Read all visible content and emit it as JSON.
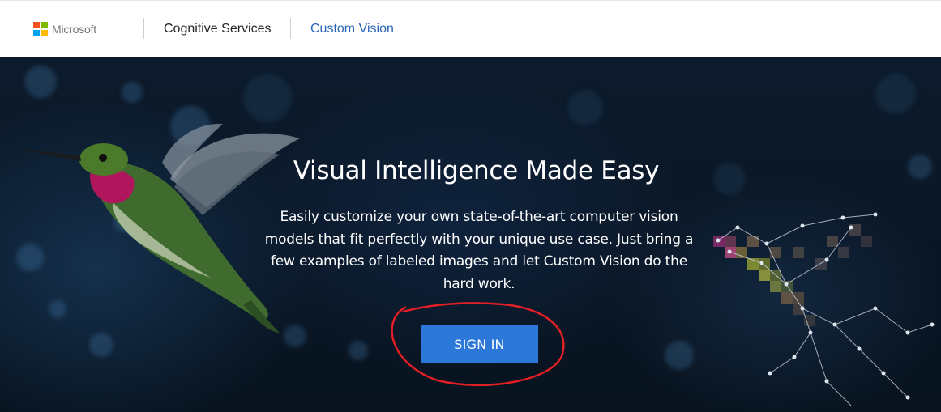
{
  "header": {
    "brand": "Microsoft",
    "nav": [
      {
        "label": "Cognitive Services"
      },
      {
        "label": "Custom Vision"
      }
    ]
  },
  "hero": {
    "title": "Visual Intelligence Made Easy",
    "description": "Easily customize your own state-of-the-art computer vision models that fit perfectly with your unique use case. Just bring a few examples of labeled images and let Custom Vision do the hard work.",
    "cta_label": "SIGN IN"
  },
  "colors": {
    "brand_red": "#f25022",
    "brand_green": "#7fba00",
    "brand_blue": "#00a4ef",
    "brand_yellow": "#ffb900",
    "link_blue": "#2b65b8",
    "button_blue": "#2b78d8",
    "annotation_red": "#e01f26"
  },
  "icons": {
    "logo": "microsoft-logo-icon"
  }
}
